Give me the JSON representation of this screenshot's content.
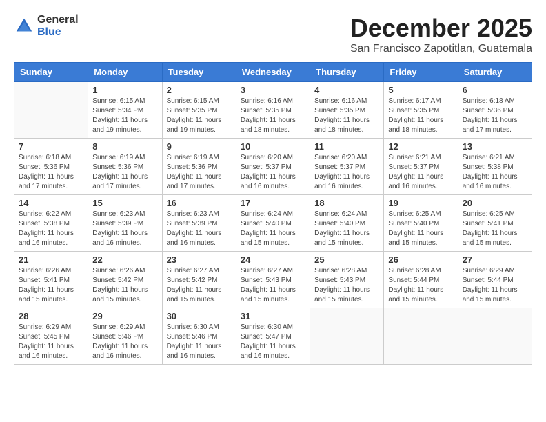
{
  "logo": {
    "general": "General",
    "blue": "Blue"
  },
  "title": "December 2025",
  "location": "San Francisco Zapotitlan, Guatemala",
  "headers": [
    "Sunday",
    "Monday",
    "Tuesday",
    "Wednesday",
    "Thursday",
    "Friday",
    "Saturday"
  ],
  "weeks": [
    [
      {
        "date": "",
        "info": ""
      },
      {
        "date": "1",
        "info": "Sunrise: 6:15 AM\nSunset: 5:34 PM\nDaylight: 11 hours\nand 19 minutes."
      },
      {
        "date": "2",
        "info": "Sunrise: 6:15 AM\nSunset: 5:35 PM\nDaylight: 11 hours\nand 19 minutes."
      },
      {
        "date": "3",
        "info": "Sunrise: 6:16 AM\nSunset: 5:35 PM\nDaylight: 11 hours\nand 18 minutes."
      },
      {
        "date": "4",
        "info": "Sunrise: 6:16 AM\nSunset: 5:35 PM\nDaylight: 11 hours\nand 18 minutes."
      },
      {
        "date": "5",
        "info": "Sunrise: 6:17 AM\nSunset: 5:35 PM\nDaylight: 11 hours\nand 18 minutes."
      },
      {
        "date": "6",
        "info": "Sunrise: 6:18 AM\nSunset: 5:36 PM\nDaylight: 11 hours\nand 17 minutes."
      }
    ],
    [
      {
        "date": "7",
        "info": "Sunrise: 6:18 AM\nSunset: 5:36 PM\nDaylight: 11 hours\nand 17 minutes."
      },
      {
        "date": "8",
        "info": "Sunrise: 6:19 AM\nSunset: 5:36 PM\nDaylight: 11 hours\nand 17 minutes."
      },
      {
        "date": "9",
        "info": "Sunrise: 6:19 AM\nSunset: 5:36 PM\nDaylight: 11 hours\nand 17 minutes."
      },
      {
        "date": "10",
        "info": "Sunrise: 6:20 AM\nSunset: 5:37 PM\nDaylight: 11 hours\nand 16 minutes."
      },
      {
        "date": "11",
        "info": "Sunrise: 6:20 AM\nSunset: 5:37 PM\nDaylight: 11 hours\nand 16 minutes."
      },
      {
        "date": "12",
        "info": "Sunrise: 6:21 AM\nSunset: 5:37 PM\nDaylight: 11 hours\nand 16 minutes."
      },
      {
        "date": "13",
        "info": "Sunrise: 6:21 AM\nSunset: 5:38 PM\nDaylight: 11 hours\nand 16 minutes."
      }
    ],
    [
      {
        "date": "14",
        "info": "Sunrise: 6:22 AM\nSunset: 5:38 PM\nDaylight: 11 hours\nand 16 minutes."
      },
      {
        "date": "15",
        "info": "Sunrise: 6:23 AM\nSunset: 5:39 PM\nDaylight: 11 hours\nand 16 minutes."
      },
      {
        "date": "16",
        "info": "Sunrise: 6:23 AM\nSunset: 5:39 PM\nDaylight: 11 hours\nand 16 minutes."
      },
      {
        "date": "17",
        "info": "Sunrise: 6:24 AM\nSunset: 5:40 PM\nDaylight: 11 hours\nand 15 minutes."
      },
      {
        "date": "18",
        "info": "Sunrise: 6:24 AM\nSunset: 5:40 PM\nDaylight: 11 hours\nand 15 minutes."
      },
      {
        "date": "19",
        "info": "Sunrise: 6:25 AM\nSunset: 5:40 PM\nDaylight: 11 hours\nand 15 minutes."
      },
      {
        "date": "20",
        "info": "Sunrise: 6:25 AM\nSunset: 5:41 PM\nDaylight: 11 hours\nand 15 minutes."
      }
    ],
    [
      {
        "date": "21",
        "info": "Sunrise: 6:26 AM\nSunset: 5:41 PM\nDaylight: 11 hours\nand 15 minutes."
      },
      {
        "date": "22",
        "info": "Sunrise: 6:26 AM\nSunset: 5:42 PM\nDaylight: 11 hours\nand 15 minutes."
      },
      {
        "date": "23",
        "info": "Sunrise: 6:27 AM\nSunset: 5:42 PM\nDaylight: 11 hours\nand 15 minutes."
      },
      {
        "date": "24",
        "info": "Sunrise: 6:27 AM\nSunset: 5:43 PM\nDaylight: 11 hours\nand 15 minutes."
      },
      {
        "date": "25",
        "info": "Sunrise: 6:28 AM\nSunset: 5:43 PM\nDaylight: 11 hours\nand 15 minutes."
      },
      {
        "date": "26",
        "info": "Sunrise: 6:28 AM\nSunset: 5:44 PM\nDaylight: 11 hours\nand 15 minutes."
      },
      {
        "date": "27",
        "info": "Sunrise: 6:29 AM\nSunset: 5:44 PM\nDaylight: 11 hours\nand 15 minutes."
      }
    ],
    [
      {
        "date": "28",
        "info": "Sunrise: 6:29 AM\nSunset: 5:45 PM\nDaylight: 11 hours\nand 16 minutes."
      },
      {
        "date": "29",
        "info": "Sunrise: 6:29 AM\nSunset: 5:46 PM\nDaylight: 11 hours\nand 16 minutes."
      },
      {
        "date": "30",
        "info": "Sunrise: 6:30 AM\nSunset: 5:46 PM\nDaylight: 11 hours\nand 16 minutes."
      },
      {
        "date": "31",
        "info": "Sunrise: 6:30 AM\nSunset: 5:47 PM\nDaylight: 11 hours\nand 16 minutes."
      },
      {
        "date": "",
        "info": ""
      },
      {
        "date": "",
        "info": ""
      },
      {
        "date": "",
        "info": ""
      }
    ]
  ]
}
